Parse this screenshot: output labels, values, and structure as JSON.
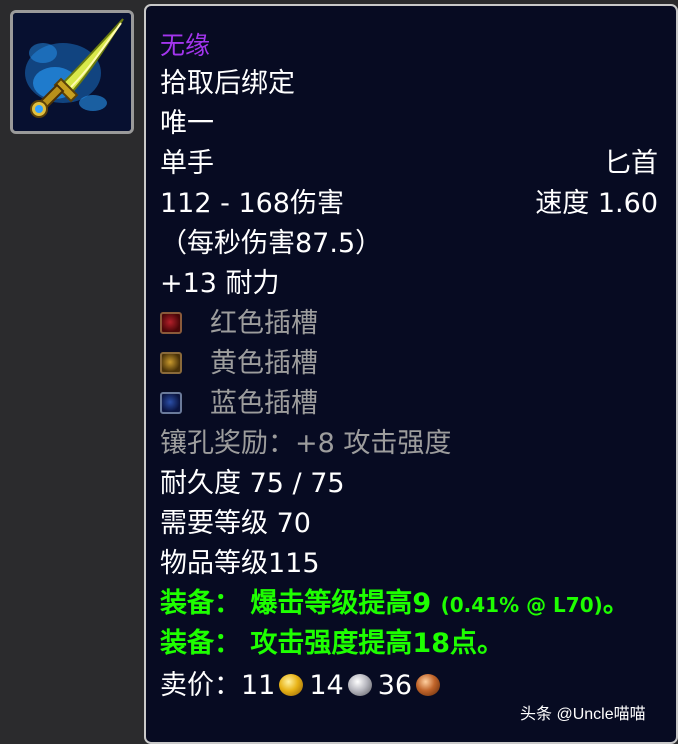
{
  "item": {
    "name": "无缘",
    "binding": "拾取后绑定",
    "unique": "唯一",
    "slot": "单手",
    "type": "匕首",
    "damage": "112 - 168伤害",
    "speed": "速度 1.60",
    "dps": "（每秒伤害87.5）",
    "stat": "+13 耐力",
    "sockets": [
      {
        "color": "red",
        "label": "红色插槽"
      },
      {
        "color": "yellow",
        "label": "黄色插槽"
      },
      {
        "color": "blue",
        "label": "蓝色插槽"
      }
    ],
    "socket_bonus": "镶孔奖励：+8 攻击强度",
    "durability": "耐久度 75 / 75",
    "required_level": "需要等级 70",
    "item_level": "物品等级115",
    "equip1_prefix": "装备：",
    "equip1_text": "爆击等级提高9",
    "equip1_detail": "(0.41% @ L70)",
    "equip1_end": "。",
    "equip2_prefix": "装备：",
    "equip2_text": "攻击强度提高18点。",
    "sell_label": "卖价：",
    "sell_gold": "11",
    "sell_silver": "14",
    "sell_copper": "36"
  },
  "watermark": "头条 @Uncle喵喵",
  "colors": {
    "quality_epic": "#a335ee",
    "equip_green": "#1eff00",
    "socket_gray": "#9d9d9d",
    "tooltip_bg": "#070b22"
  }
}
